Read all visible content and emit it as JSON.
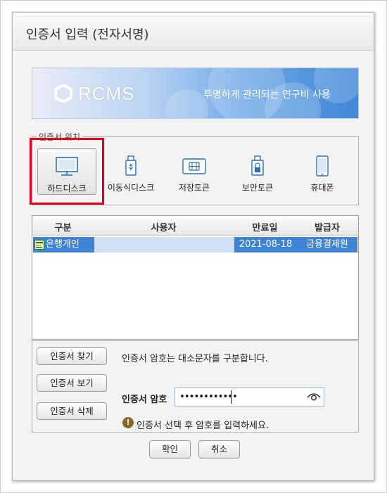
{
  "dialog": {
    "title": "인증서 입력 (전자서명)"
  },
  "banner": {
    "logo_text": "RCMS",
    "slogan": "투명하게 관리되는 연구비 사용"
  },
  "cert_location": {
    "legend": "인증서 위치",
    "items": [
      {
        "label": "하드디스크",
        "icon": "monitor-icon",
        "selected": true
      },
      {
        "label": "이동식디스크",
        "icon": "usb-drive-icon",
        "selected": false
      },
      {
        "label": "저장토큰",
        "icon": "smartcard-icon",
        "selected": false
      },
      {
        "label": "보안토큰",
        "icon": "security-token-icon",
        "selected": false
      },
      {
        "label": "휴대폰",
        "icon": "mobile-phone-icon",
        "selected": false
      }
    ]
  },
  "cert_table": {
    "columns": [
      "구분",
      "사용자",
      "만료일",
      "발급자"
    ],
    "rows": [
      {
        "type": "은행개인",
        "user": "",
        "expires": "2021-08-18",
        "issuer": "금융결제원",
        "selected": true
      }
    ]
  },
  "password_panel": {
    "find_button": "인증서 찾기",
    "view_button": "인증서 보기",
    "delete_button": "인증서 삭제",
    "case_notice": "인증서 암호는 대소문자를 구분합니다.",
    "password_label": "인증서 암호",
    "password_value": "••••••••••••",
    "hint": "인증서 선택 후 암호를 입력하세요."
  },
  "footer": {
    "ok_button": "확인",
    "cancel_button": "취소"
  },
  "colors": {
    "highlight": "#e3001b",
    "selection": "#3f83d6",
    "banner_blue": "#3f87d8"
  }
}
